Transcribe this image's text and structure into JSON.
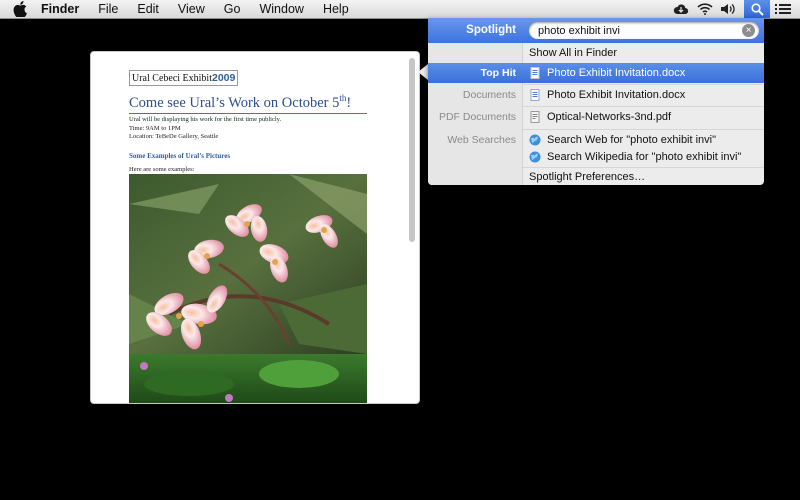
{
  "menubar": {
    "app": "Finder",
    "menus": [
      "File",
      "Edit",
      "View",
      "Go",
      "Window",
      "Help"
    ],
    "icons": [
      "apple-logo",
      "cloud-icon",
      "wifi-icon",
      "volume-icon",
      "spotlight-search-icon",
      "notification-list-icon"
    ]
  },
  "preview": {
    "title": "Ural Cebeci Exhibit",
    "year": "2009",
    "heading": "Come see Ural’s Work on October 5",
    "heading_sup": "th",
    "heading_end": "!",
    "body_lines": [
      "Ural will be displaying his work for the first time publicly.",
      "Time: 9AM to 1PM",
      "Location: TeBeDe Gallery, Seattle"
    ],
    "subheading": "Some Examples of Ural’s Pictures",
    "note": "Here are some examples:"
  },
  "spotlight": {
    "label": "Spotlight",
    "query": "photo exhibit invi",
    "show_all": "Show All in Finder",
    "top_hit": {
      "category": "Top Hit",
      "name": "Photo Exhibit Invitation.docx"
    },
    "documents": {
      "category": "Documents",
      "name": "Photo Exhibit Invitation.docx"
    },
    "pdf": {
      "category": "PDF Documents",
      "name": "Optical-Networks-3nd.pdf"
    },
    "web": {
      "category": "Web Searches",
      "web_search": "Search Web for \"photo exhibit invi\"",
      "wikipedia": "Search Wikipedia for \"photo exhibit invi\""
    },
    "preferences": "Spotlight Preferences…"
  }
}
